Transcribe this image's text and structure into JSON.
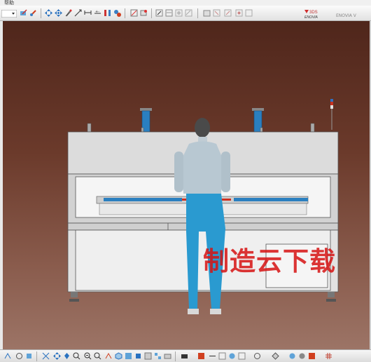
{
  "menubar": {
    "label": "帮助"
  },
  "brand": {
    "logo": "3DS ENOVIA",
    "label": "ENOVIA V"
  },
  "watermark": {
    "text": "制造云下载"
  },
  "colors": {
    "background_top": "#4f261b",
    "background_bottom": "#9c7466",
    "watermark": "#d61212",
    "machine_frame": "#dcdcdc",
    "human_upper": "#b8c8d2",
    "human_lower": "#2a9ad0",
    "cylinder": "#2a7fc0"
  },
  "toolbar_top": {
    "icons": [
      "dropdown-icon",
      "sketch-icon",
      "measure-icon",
      "pan-icon",
      "move-icon",
      "compass-icon",
      "snap-icon",
      "dimension-icon",
      "constraint-icon",
      "update-icon",
      "parts-icon",
      "measure-item-icon",
      "swap-icon",
      "capture-icon",
      "compare-icon",
      "product-icon",
      "copy-icon",
      "paste-icon",
      "ground-icon",
      "enovia-logo"
    ]
  },
  "toolbar_bottom": {
    "icons": [
      "fly-icon",
      "rotate-icon",
      "explode-icon",
      "fit-all-icon",
      "pan-icon",
      "rotate-view-icon",
      "zoom-in-icon",
      "zoom-out-icon",
      "normal-view-icon",
      "iso-view-icon",
      "shading-icon",
      "hide-show-icon",
      "swap-visible-icon",
      "multi-view-icon",
      "camera-icon",
      "sectioning-icon",
      "clash-icon",
      "distance-icon",
      "annotation-icon",
      "snapshot-icon",
      "catalog-icon",
      "cube-icon",
      "render-icon",
      "save-icon",
      "grid-icon"
    ]
  }
}
